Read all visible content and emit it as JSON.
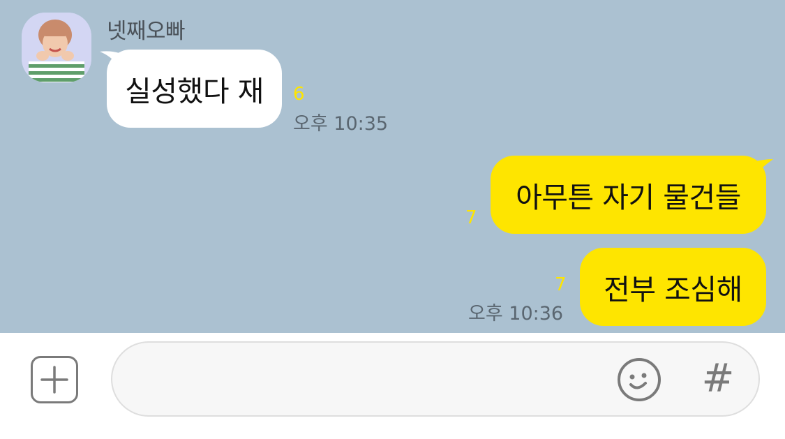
{
  "chat": {
    "sender_name": "넷째오빠",
    "messages": [
      {
        "direction": "incoming",
        "text": "실성했다 재",
        "unread": "6",
        "time": "오후 10:35"
      },
      {
        "direction": "outgoing",
        "text": "아무튼 자기 물건들",
        "unread": "7",
        "time": ""
      },
      {
        "direction": "outgoing",
        "text": "전부 조심해",
        "unread": "7",
        "time": "오후 10:36"
      }
    ]
  },
  "input_bar": {
    "message_value": "",
    "plus_icon": "plus-square-icon",
    "emoji_icon": "smiley-icon",
    "hash_label": "#"
  },
  "colors": {
    "chat_background": "#abc1d1",
    "outgoing_bubble": "#fee500",
    "incoming_bubble": "#ffffff",
    "unread_count": "#fee500"
  }
}
